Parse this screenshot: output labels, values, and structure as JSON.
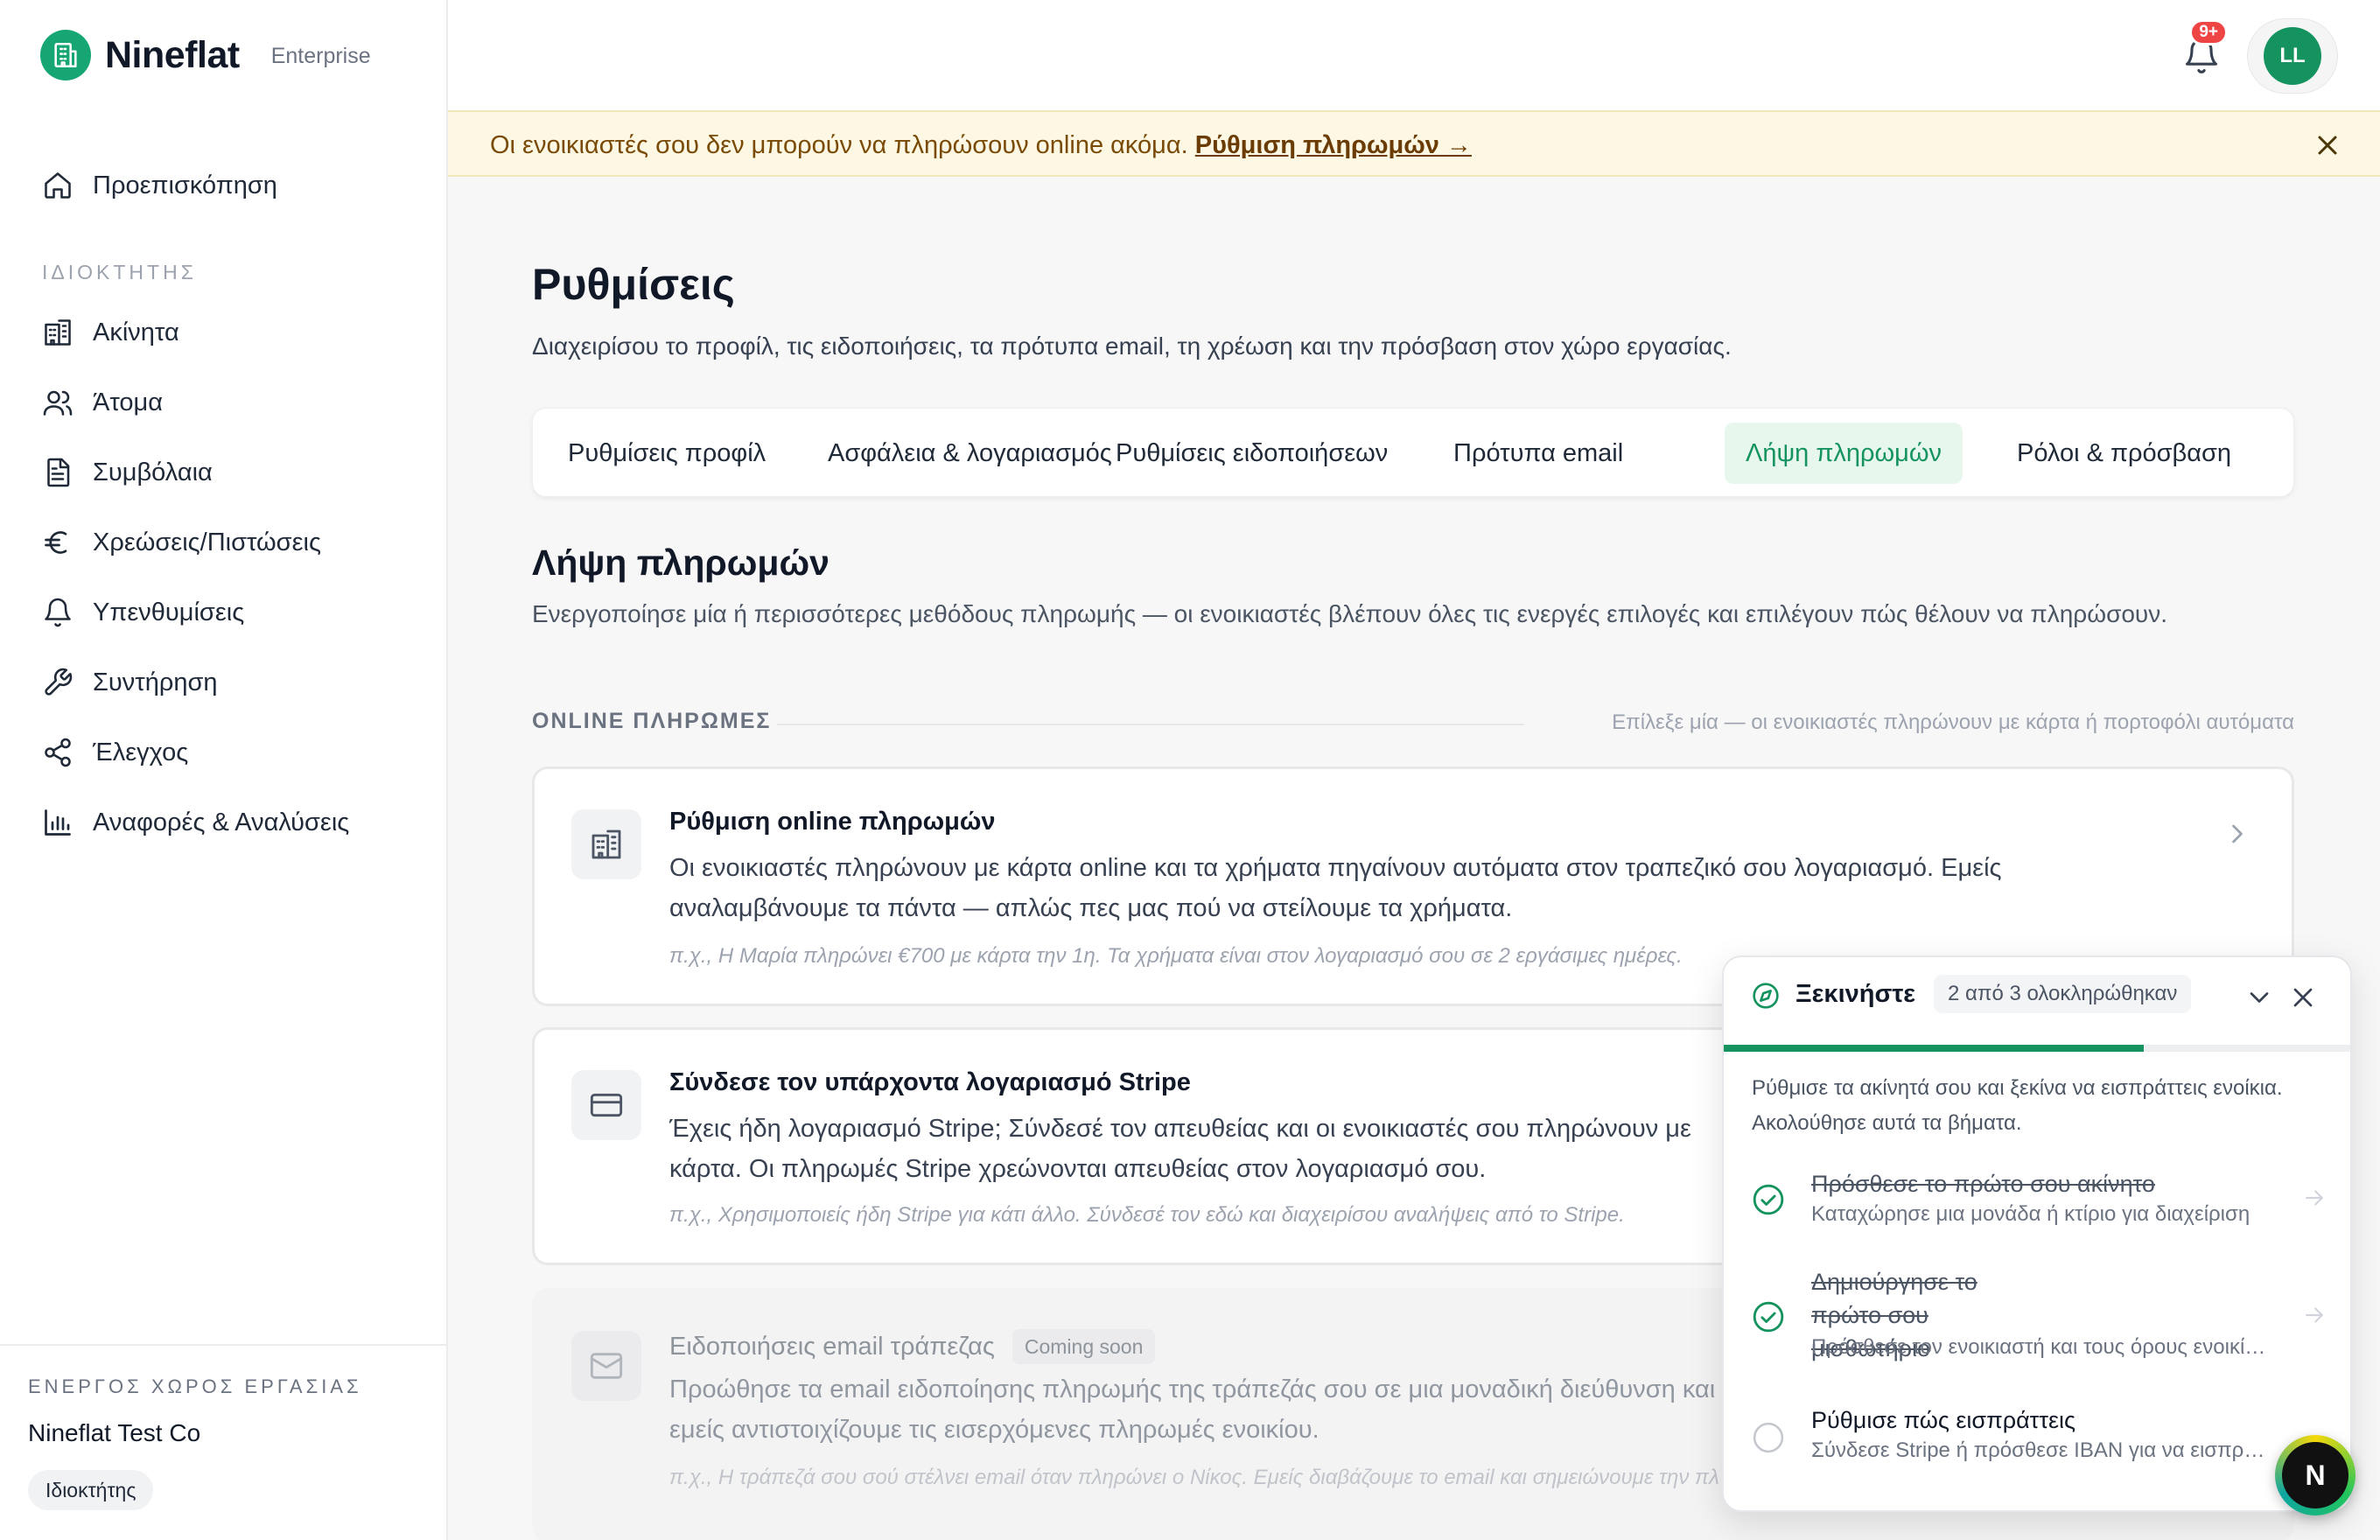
{
  "brand": {
    "name": "Nineflat",
    "tier": "Enterprise"
  },
  "sidebar": {
    "overview": {
      "label": "Προεπισκόπηση",
      "icon": "home-icon"
    },
    "section_owner": "ΙΔΙΟΚΤΗΤΗΣ",
    "items": [
      {
        "label": "Ακίνητα",
        "icon": "building-icon"
      },
      {
        "label": "Άτομα",
        "icon": "users-icon"
      },
      {
        "label": "Συμβόλαια",
        "icon": "document-icon"
      },
      {
        "label": "Χρεώσεις/Πιστώσεις",
        "icon": "euro-icon"
      },
      {
        "label": "Υπενθυμίσεις",
        "icon": "bell-icon"
      },
      {
        "label": "Συντήρηση",
        "icon": "wrench-icon"
      },
      {
        "label": "Έλεγχος",
        "icon": "share-icon"
      },
      {
        "label": "Αναφορές & Αναλύσεις",
        "icon": "bar-chart-icon"
      }
    ],
    "workspace": {
      "title": "ΕΝΕΡΓΟΣ ΧΩΡΟΣ ΕΡΓΑΣΙΑΣ",
      "name": "Nineflat Test Co",
      "role": "Ιδιοκτήτης"
    }
  },
  "topbar": {
    "notification_badge": "9+",
    "avatar_initials": "LL"
  },
  "banner": {
    "text": "Οι ενοικιαστές σου δεν μπορούν να πληρώσουν online ακόμα. ",
    "link": "Ρύθμιση πληρωμών →"
  },
  "page": {
    "title": "Ρυθμίσεις",
    "subtitle": "Διαχειρίσου το προφίλ, τις ειδοποιήσεις, τα πρότυπα email, τη χρέωση και την πρόσβαση στον χώρο εργασίας."
  },
  "tabs": [
    {
      "label": "Ρυθμίσεις προφίλ"
    },
    {
      "label": "Ασφάλεια & λογαριασμός"
    },
    {
      "label": "Ρυθμίσεις ειδοποιήσεων"
    },
    {
      "label": "Πρότυπα email"
    },
    {
      "label": "Λήψη πληρωμών",
      "active": true
    },
    {
      "label": "Ρόλοι & πρόσβαση"
    }
  ],
  "section": {
    "title": "Λήψη πληρωμών",
    "description": "Ενεργοποίησε μία ή περισσότερες μεθόδους πληρωμής — οι ενοικιαστές βλέπουν όλες τις ενεργές επιλογές και επιλέγουν πώς θέλουν να πληρώσουν.",
    "group_title": "ONLINE ΠΛΗΡΩΜΕΣ",
    "group_hint": "Επίλεξε μία — οι ενοικιαστές πληρώνουν με κάρτα ή πορτοφόλι αυτόματα"
  },
  "cards": [
    {
      "title": "Ρύθμιση online πληρωμών",
      "description": "Οι ενοικιαστές πληρώνουν με κάρτα online και τα χρήματα πηγαίνουν αυτόματα στον τραπεζικό σου λογαριασμό. Εμείς αναλαμβάνουμε τα πάντα — απλώς πες μας πού να στείλουμε τα χρήματα.",
      "example": "π.χ., Η Μαρία πληρώνει €700 με κάρτα την 1η. Τα χρήματα είναι στον λογαριασμό σου σε 2 εργάσιμες ημέρες.",
      "icon": "bank-building-icon"
    },
    {
      "title": "Σύνδεσε τον υπάρχοντα λογαριασμό Stripe",
      "description": "Έχεις ήδη λογαριασμό Stripe; Σύνδεσέ τον απευθείας και οι ενοικιαστές σου πληρώνουν με κάρτα. Οι πληρωμές Stripe χρεώνονται απευθείας στον λογαριασμό σου.",
      "example": "π.χ., Χρησιμοποιείς ήδη Stripe για κάτι άλλο. Σύνδεσέ τον εδώ και διαχειρίσου αναλήψεις από το Stripe.",
      "icon": "credit-card-icon"
    },
    {
      "title": "Ειδοποιήσεις email τράπεζας",
      "badge": "Coming soon",
      "description": "Προώθησε τα email ειδοποίησης πληρωμής της τράπεζάς σου σε μια μοναδική διεύθυνση και εμείς αντιστοιχίζουμε τις εισερχόμενες πληρωμές ενοικίου.",
      "example": "π.χ., Η τράπεζά σου σού στέλνει email όταν πληρώνει ο Νίκος. Εμείς διαβάζουμε το email και σημειώνουμε την πληρωμή.",
      "icon": "mail-icon"
    }
  ],
  "getting_started": {
    "title": "Ξεκινήστε",
    "count": "2 από 3 ολοκληρώθηκαν",
    "progress": 0.67,
    "description": "Ρύθμισε τα ακίνητά σου και ξεκίνα να εισπράττεις ενοίκια. Ακολούθησε αυτά τα βήματα.",
    "steps": [
      {
        "title": "Πρόσθεσε το πρώτο σου ακίνητο",
        "subtitle": "Καταχώρησε μια μονάδα ή κτίριο για διαχείριση",
        "done": true
      },
      {
        "title": "Δημιούργησε το πρώτο σου μισθωτήριο",
        "subtitle": "Πρόσθεσε τον ενοικιαστή και τους όρους ενοικίου",
        "done": true
      },
      {
        "title": "Ρύθμισε πώς εισπράττεις",
        "subtitle": "Σύνδεσε Stripe ή πρόσθεσε IBAN για να εισπράττεις",
        "done": false
      }
    ]
  },
  "fab": {
    "label": "N"
  },
  "colors": {
    "brand_green": "#15935f",
    "accent_green": "#16a673",
    "badge_red": "#ef4444",
    "banner_bg": "#fdf8e3"
  }
}
